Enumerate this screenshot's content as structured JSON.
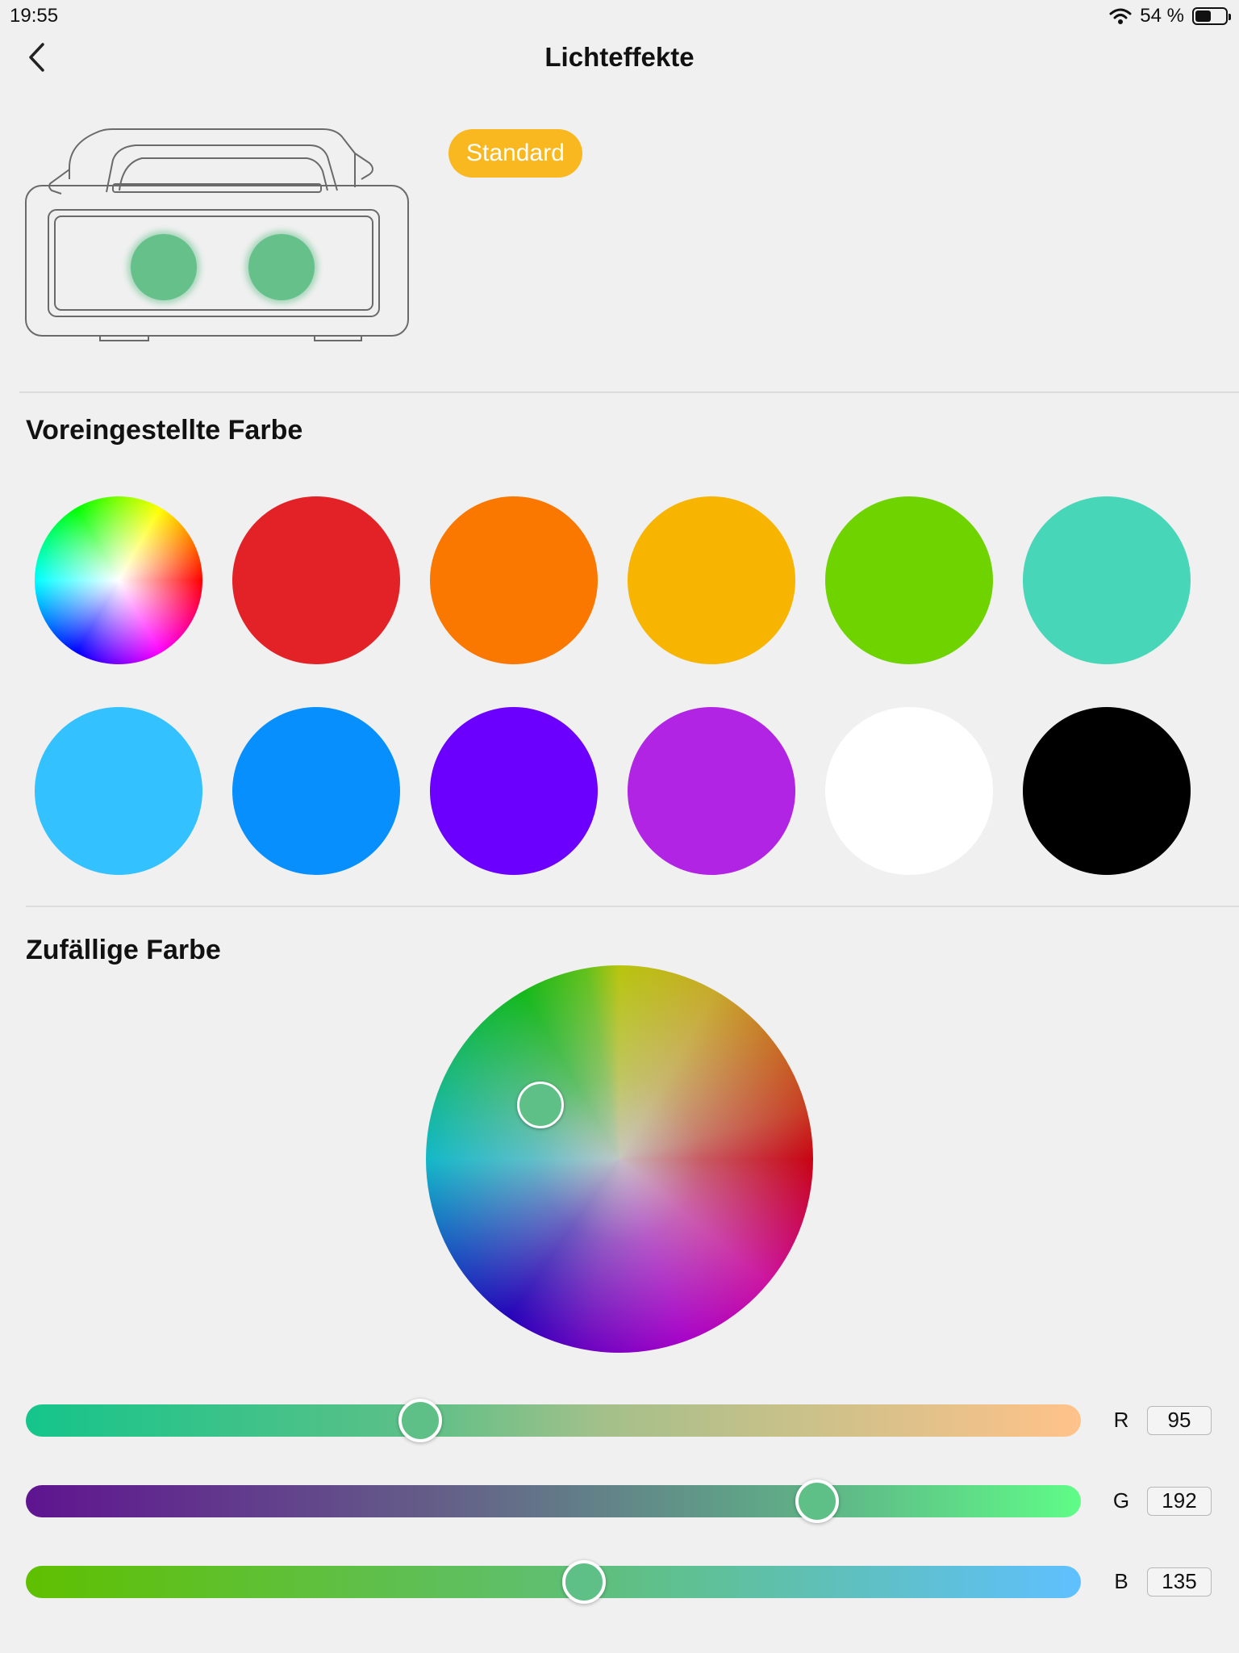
{
  "status_bar": {
    "time": "19:55",
    "battery_text": "54 %",
    "battery_level": 0.54
  },
  "header": {
    "title": "Lichteffekte",
    "back_icon": "chevron-left-icon"
  },
  "device": {
    "mode_badge": "Standard",
    "light_color": "#65c08a"
  },
  "preset_section": {
    "title": "Voreingestellte Farbe",
    "colors": [
      "multicolor",
      "#e32227",
      "#fa7800",
      "#f7b400",
      "#6fd300",
      "#47d7b8",
      "#33c1ff",
      "#068ffd",
      "#6b00ff",
      "#b224e4",
      "#ffffff",
      "#000000"
    ]
  },
  "random_section": {
    "title": "Zufällige Farbe",
    "selected_color": "#5fc087"
  },
  "rgb": {
    "r": {
      "label": "R",
      "value": "95"
    },
    "g": {
      "label": "G",
      "value": "192"
    },
    "b": {
      "label": "B",
      "value": "135"
    }
  }
}
